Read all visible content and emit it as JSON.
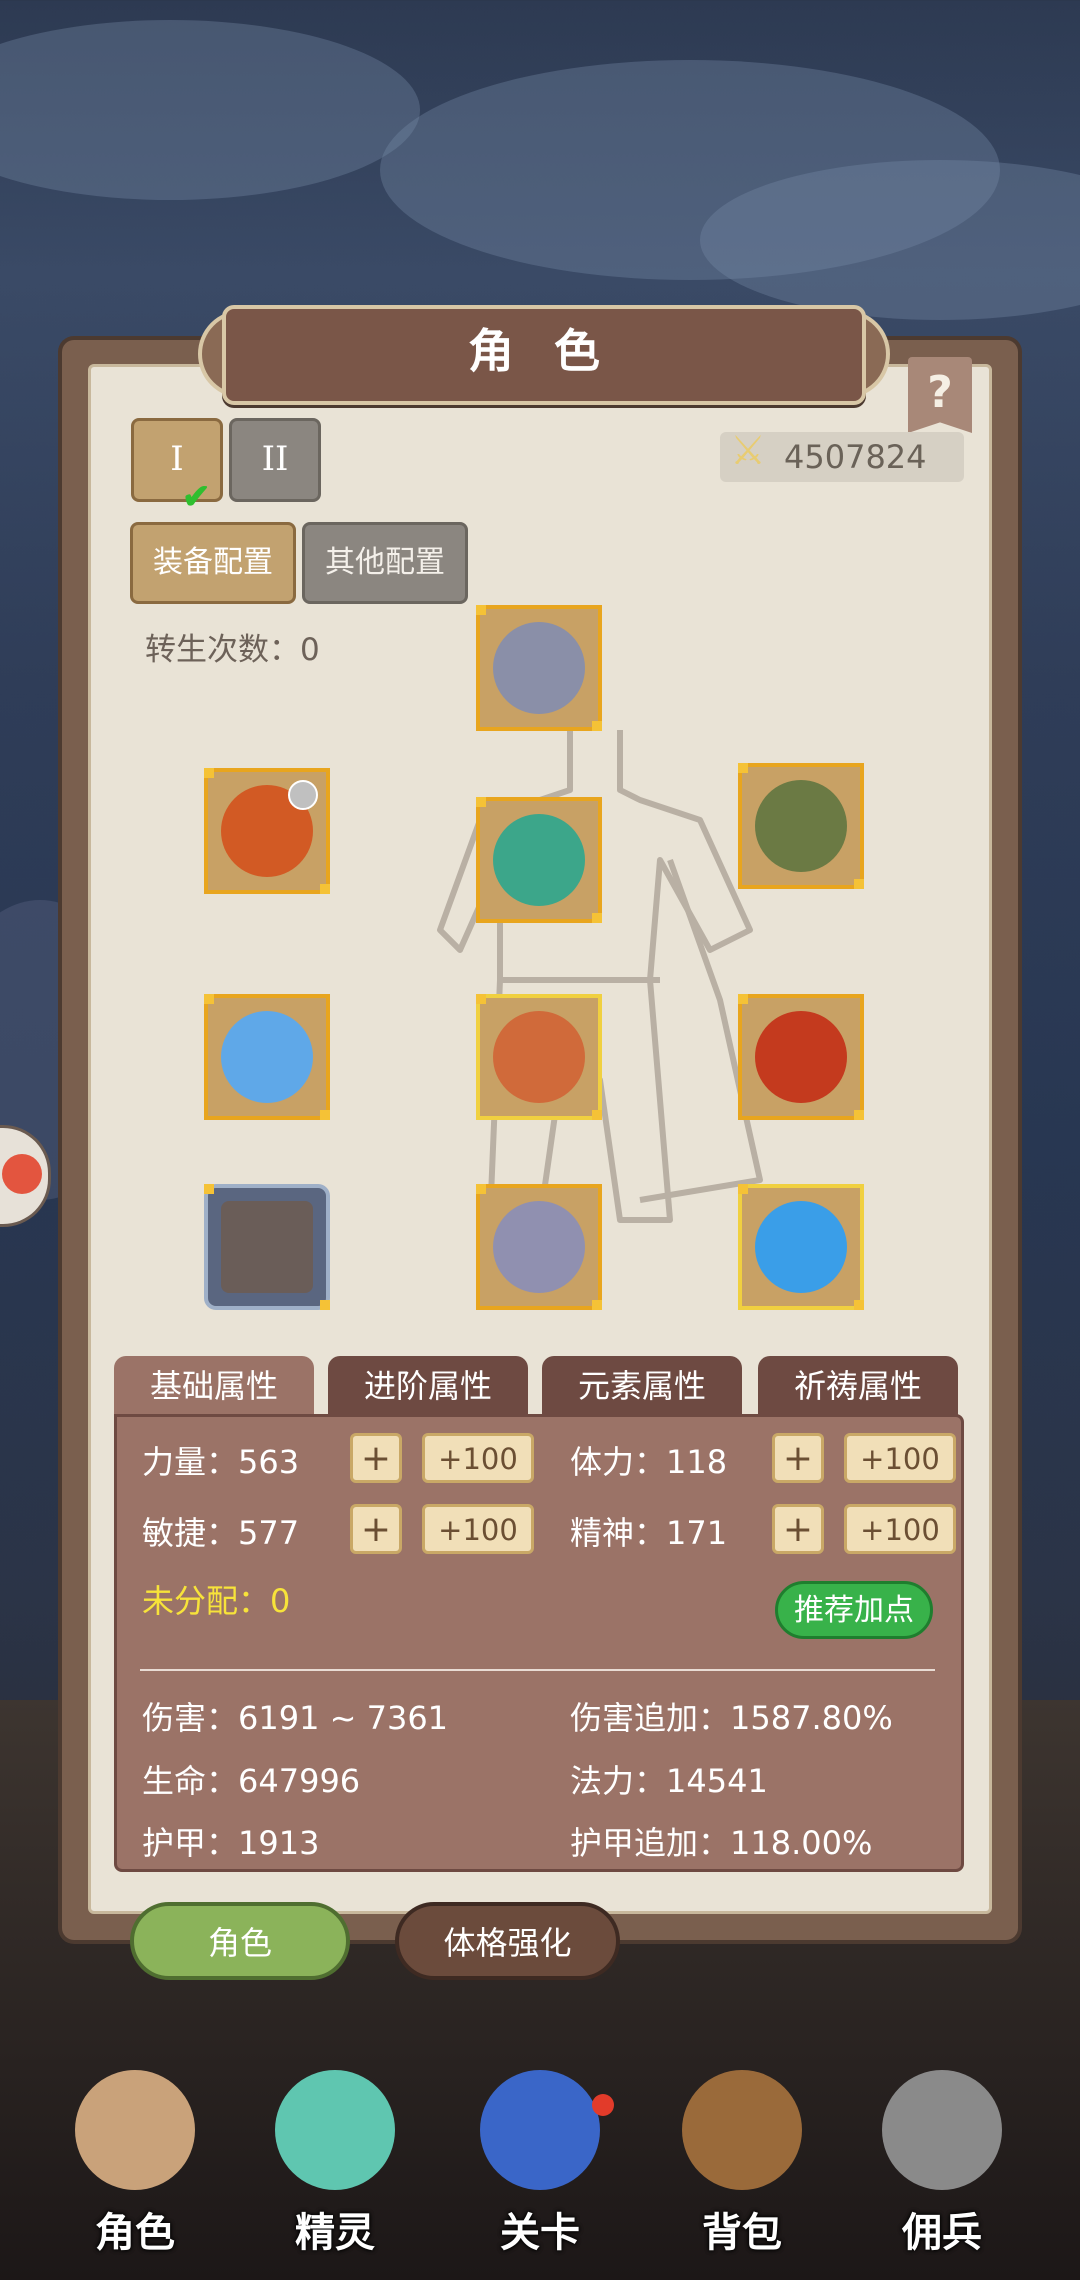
{
  "title": "角 色",
  "help_label": "?",
  "preset_tabs": [
    "I",
    "II"
  ],
  "power": "4507824",
  "config_buttons": {
    "equipment": "装备配置",
    "other": "其他配置"
  },
  "rebirth": "转生次数：0",
  "equipment_slots": [
    {
      "name": "helmet",
      "icon": "helmet-icon",
      "color": "#8a8fa8"
    },
    {
      "name": "weapon",
      "icon": "sword-icon",
      "color": "#d25a24"
    },
    {
      "name": "armor",
      "icon": "armor-icon",
      "color": "#3ca68a"
    },
    {
      "name": "gloves",
      "icon": "gloves-icon",
      "color": "#6b7a44"
    },
    {
      "name": "amulet",
      "icon": "crystal-icon",
      "color": "#5fa8e8"
    },
    {
      "name": "belt",
      "icon": "belt-icon",
      "color": "#d06a3a"
    },
    {
      "name": "shield",
      "icon": "shield-icon",
      "color": "#c43a1e"
    },
    {
      "name": "costume",
      "icon": "costume-icon",
      "color": "#6a5d58"
    },
    {
      "name": "boots",
      "icon": "boots-icon",
      "color": "#9090b0"
    },
    {
      "name": "gem",
      "icon": "gem-icon",
      "color": "#3a9ee8"
    }
  ],
  "attribute_tabs": [
    "基础属性",
    "进阶属性",
    "元素属性",
    "祈祷属性"
  ],
  "stats": {
    "strength": "力量：563",
    "stamina": "体力：118",
    "agility": "敏捷：577",
    "spirit": "精神：171"
  },
  "plus_small": "+",
  "plus_large": "+100",
  "unassigned": "未分配：0",
  "recommend": "推荐加点",
  "derived": {
    "damage": "伤害：6191 ~ 7361",
    "damage_bonus": "伤害追加：1587.80%",
    "life": "生命：647996",
    "mana": "法力：14541",
    "armor": "护甲：1913",
    "armor_bonus": "护甲追加：118.00%"
  },
  "bottom_tabs": {
    "role": "角色",
    "physique": "体格强化"
  },
  "nav": [
    "角色",
    "精灵",
    "关卡",
    "背包",
    "佣兵"
  ]
}
